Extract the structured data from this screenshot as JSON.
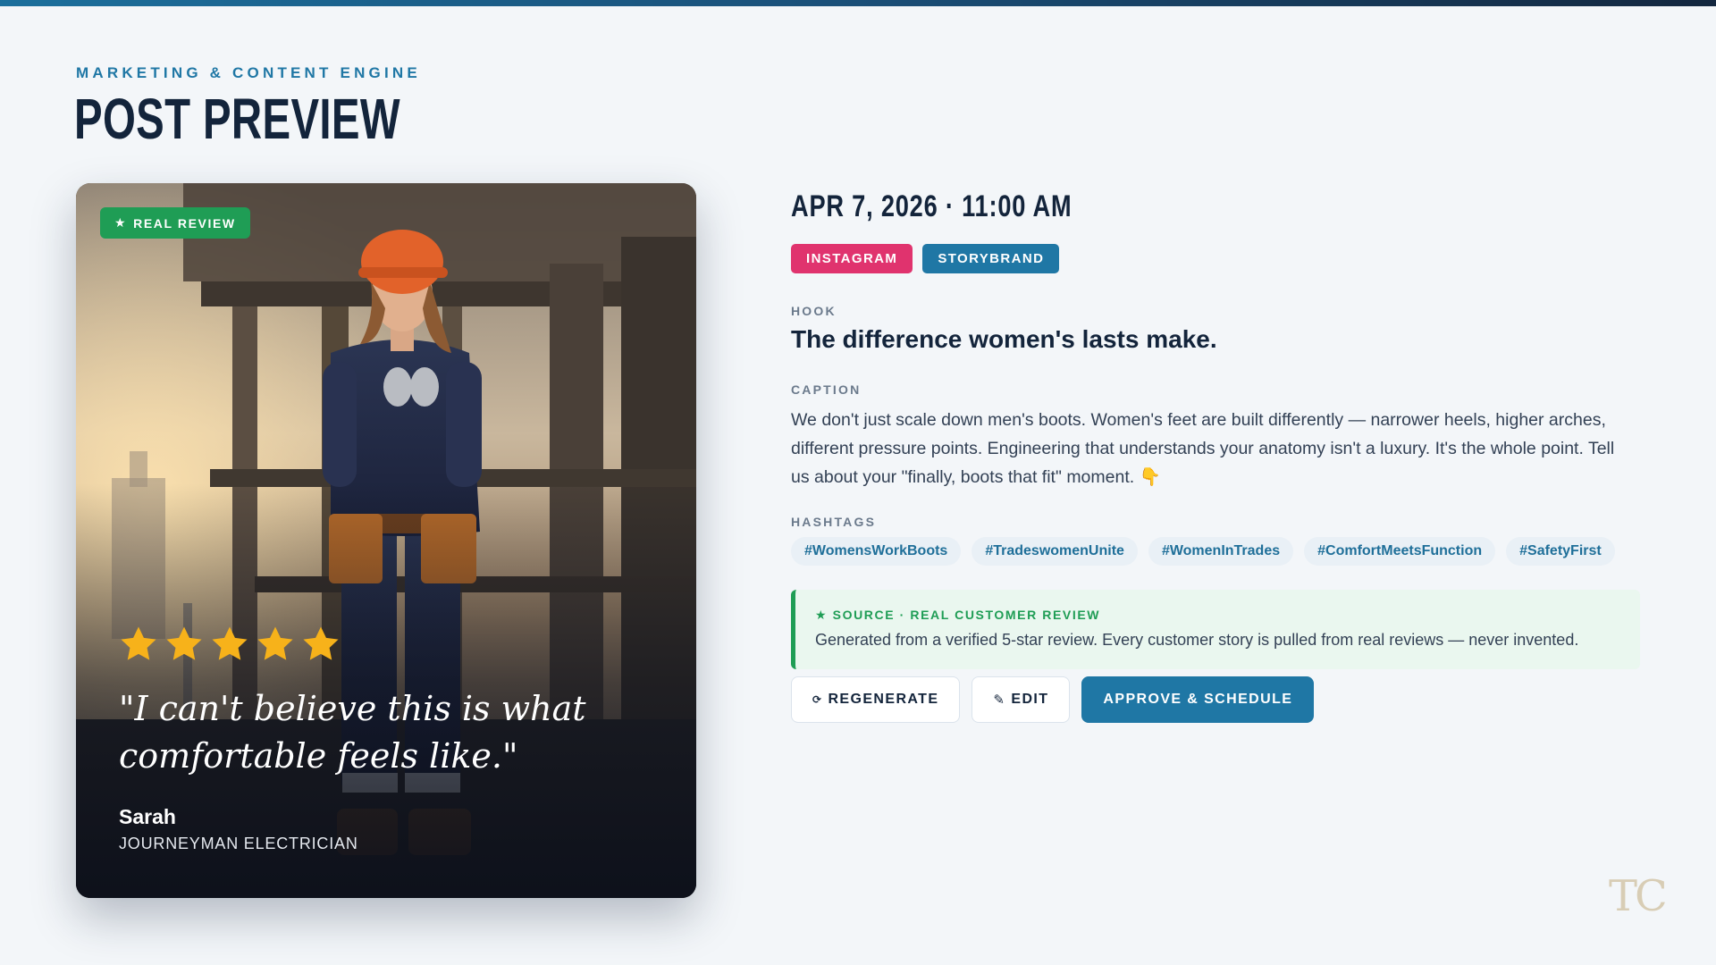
{
  "header": {
    "eyebrow": "MARKETING & CONTENT ENGINE",
    "title": "POST PREVIEW"
  },
  "card": {
    "badge_label": "REAL REVIEW",
    "badge_icon": "star-icon",
    "rating": 5,
    "rating_max": 5,
    "quote": "\"I can't believe this is what comfortable feels like.\"",
    "author_name": "Sarah",
    "author_role": "JOURNEYMAN ELECTRICIAN",
    "star_color": "#f7b21a"
  },
  "post": {
    "datetime": "APR 7, 2026 · 11:00 AM",
    "tags": [
      {
        "label": "INSTAGRAM",
        "color": "#e0336e"
      },
      {
        "label": "STORYBRAND",
        "color": "#1f77a5"
      }
    ],
    "hook_label": "HOOK",
    "hook": "The difference women's lasts make.",
    "caption_label": "CAPTION",
    "caption": "We don't just scale down men's boots. Women's feet are built differently — narrower heels, higher arches, different pressure points. Engineering that understands your anatomy isn't a luxury. It's the whole point. Tell us about your \"finally, boots that fit\" moment. 👇",
    "hashtags_label": "HASHTAGS",
    "hashtags": [
      "#WomensWorkBoots",
      "#TradeswomenUnite",
      "#WomenInTrades",
      "#ComfortMeetsFunction",
      "#SafetyFirst"
    ]
  },
  "source": {
    "title": "SOURCE · REAL CUSTOMER REVIEW",
    "body": "Generated from a verified 5-star review. Every customer story is pulled from real reviews — never invented."
  },
  "actions": {
    "regenerate_icon": "⟳",
    "regenerate": "REGENERATE",
    "edit_icon": "✎",
    "edit": "EDIT",
    "approve": "APPROVE & SCHEDULE"
  },
  "logo": "TC"
}
